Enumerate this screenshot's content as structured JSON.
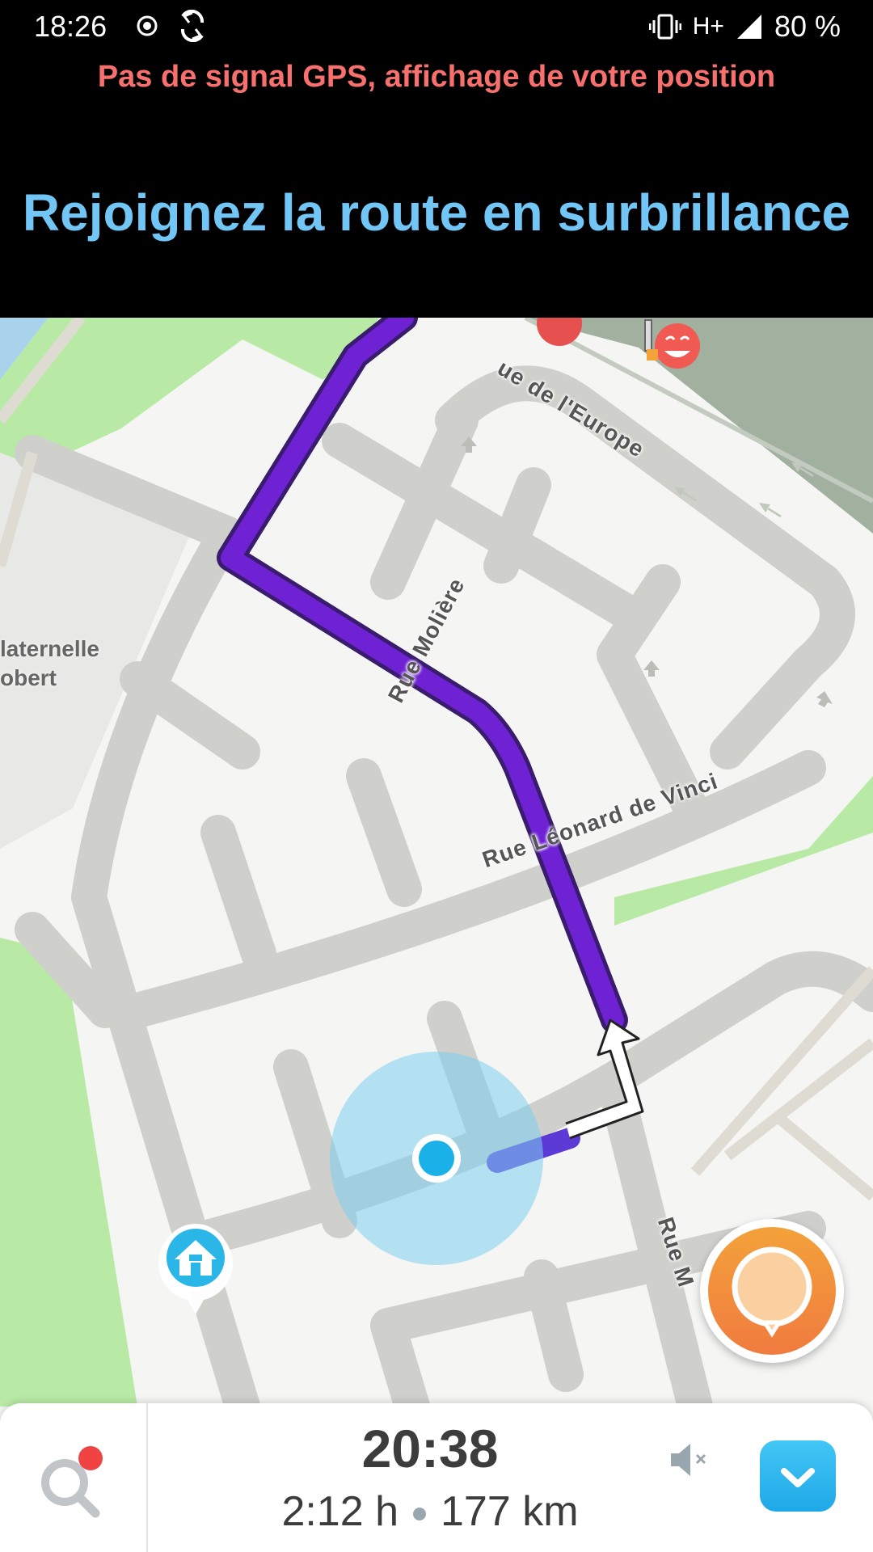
{
  "status_bar": {
    "time": "18:26",
    "network": "H+",
    "battery": "80 %",
    "icons": [
      "location-icon",
      "sync-icon",
      "vibrate-icon",
      "signal-icon",
      "battery-icon"
    ]
  },
  "gps_warning": "Pas de signal GPS, affichage de votre position",
  "instruction": "Rejoignez la route en surbrillance",
  "map": {
    "streets": {
      "europe": "ue de l'Europe",
      "moliere": "Rue Molière",
      "vinci": "Rue Léonard de Vinci",
      "bottom": "Rue M"
    },
    "poi": {
      "line1": "laternelle",
      "line2": "obert"
    },
    "route_color": "#6f22d4",
    "position_color": "#1ab0e8",
    "home_icon": "home-icon"
  },
  "bottom_bar": {
    "eta": "20:38",
    "duration": "2:12 h",
    "distance": "177 km"
  }
}
